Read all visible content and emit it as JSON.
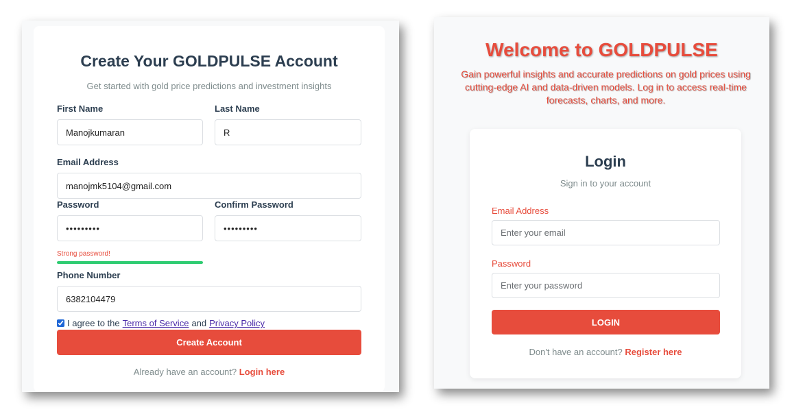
{
  "register": {
    "title": "Create Your GOLDPULSE Account",
    "subtitle": "Get started with gold price predictions and investment insights",
    "first_name_label": "First Name",
    "first_name_value": "Manojkumaran",
    "last_name_label": "Last Name",
    "last_name_value": "R",
    "email_label": "Email Address",
    "email_value": "manojmk5104@gmail.com",
    "password_label": "Password",
    "password_value": "•••••••••",
    "confirm_label": "Confirm Password",
    "confirm_value": "•••••••••",
    "strength_text": "Strong password!",
    "strength_level": 1.0,
    "strength_color": "#2ecc71",
    "phone_label": "Phone Number",
    "phone_value": "6382104479",
    "agree_checked": true,
    "agree_prefix": "I agree to the",
    "terms_link": "Terms of Service",
    "agree_and": "and",
    "privacy_link": "Privacy Policy",
    "submit_label": "Create Account",
    "footer_text": "Already have an account?",
    "footer_link": "Login here"
  },
  "welcome": {
    "title": "Welcome to GOLDPULSE",
    "text": "Gain powerful insights and accurate predictions on gold prices using cutting-edge AI and data-driven models. Log in to access real-time forecasts, charts, and more."
  },
  "login": {
    "title": "Login",
    "subtitle": "Sign in to your account",
    "email_label": "Email Address",
    "email_placeholder": "Enter your email",
    "password_label": "Password",
    "password_placeholder": "Enter your password",
    "submit_label": "LOGIN",
    "footer_text": "Don't have an account?",
    "footer_link": "Register here"
  },
  "colors": {
    "accent": "#e74c3c",
    "heading": "#2c3e50",
    "muted": "#7f8c8d",
    "success": "#2ecc71"
  }
}
